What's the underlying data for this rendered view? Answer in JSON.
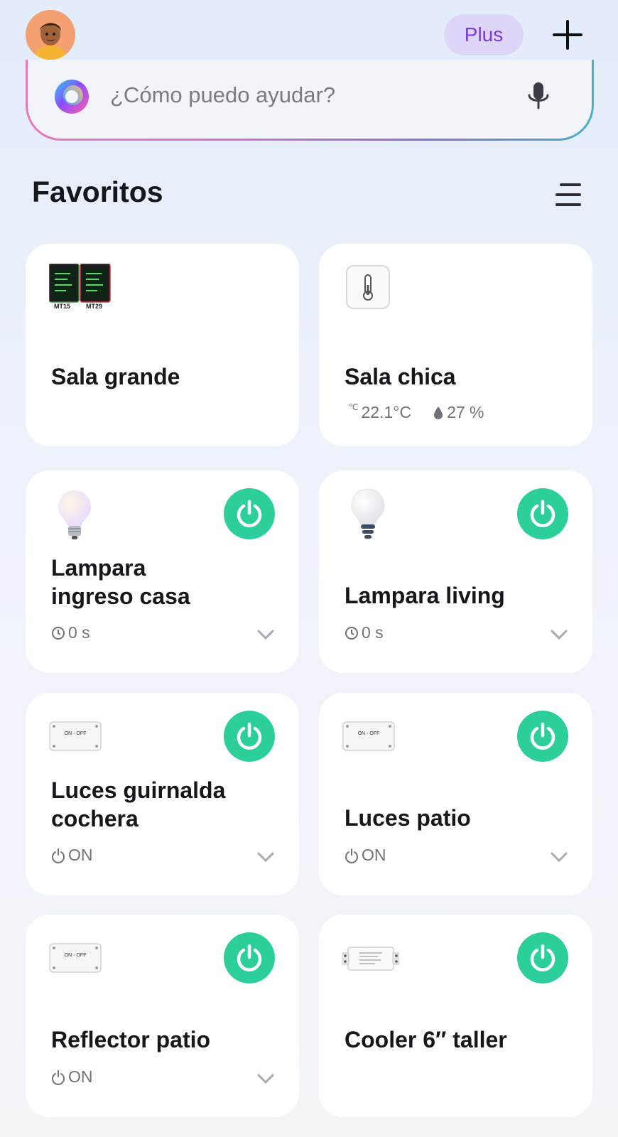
{
  "header": {
    "avatar_icon": "user-avatar-icon",
    "plus_label": "Plus",
    "add_icon": "plus-icon"
  },
  "search": {
    "placeholder": "¿Cómo puedo ayudar?",
    "logo_icon": "assistant-logo-icon",
    "mic_icon": "microphone-icon"
  },
  "favorites": {
    "title": "Favoritos",
    "menu_icon": "list-menu-icon"
  },
  "colors": {
    "power_on": "#2ccf9b",
    "plus_bg": "#ddd6f8",
    "plus_text": "#7a3bd8",
    "card_bg": "#ffffff"
  },
  "cards": [
    {
      "name": "Sala grande",
      "image": "thermo-hygrometer-panels-image",
      "img_label_1": "MT15",
      "img_label_2": "MT29"
    },
    {
      "name": "Sala chica",
      "image": "thermometer-sensor-icon",
      "temperature": "22.1°C",
      "temp_unit_icon": "℃",
      "humidity": "27 %"
    },
    {
      "name_line1": "Lampara",
      "name_line2": "ingreso casa",
      "image": "warm-bulb-icon",
      "status": "0 s",
      "status_icon": "clock-icon",
      "power": true
    },
    {
      "name": "Lampara living",
      "image": "bulb-icon",
      "status": "0 s",
      "status_icon": "clock-icon",
      "power": true
    },
    {
      "name_line1": "Luces guirnalda",
      "name_line2": "cochera",
      "image": "switch-module-icon",
      "switch_label": "ON ◦ OFF",
      "status": "ON",
      "status_icon": "power-icon",
      "power": true
    },
    {
      "name": "Luces patio",
      "image": "switch-module-icon",
      "switch_label": "ON ◦ OFF",
      "status": "ON",
      "status_icon": "power-icon",
      "power": true
    },
    {
      "name": "Reflector patio",
      "image": "switch-module-icon",
      "switch_label": "ON ◦ OFF",
      "status": "ON",
      "status_icon": "power-icon",
      "power": true
    },
    {
      "name": "Cooler 6″ taller",
      "image": "relay-module-icon",
      "power": true
    }
  ]
}
